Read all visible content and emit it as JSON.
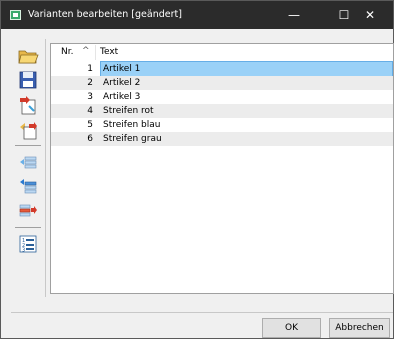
{
  "window": {
    "title": "Varianten bearbeiten [geändert]",
    "min_glyph": "—",
    "max_glyph": "☐",
    "close_glyph": "✕"
  },
  "toolbar": {
    "icons": [
      "open-folder-icon",
      "save-icon",
      "import-icon",
      "export-icon",
      "insert-before-icon",
      "insert-after-icon",
      "move-right-icon",
      "numbered-list-icon"
    ]
  },
  "list": {
    "columns": {
      "nr": "Nr.",
      "sort_glyph": "^",
      "text": "Text"
    },
    "rows": [
      {
        "nr": "1",
        "text": "Artikel 1",
        "selected": true
      },
      {
        "nr": "2",
        "text": "Artikel 2"
      },
      {
        "nr": "3",
        "text": "Artikel 3"
      },
      {
        "nr": "4",
        "text": "Streifen rot"
      },
      {
        "nr": "5",
        "text": "Streifen blau"
      },
      {
        "nr": "6",
        "text": "Streifen grau"
      }
    ]
  },
  "buttons": {
    "ok": "OK",
    "cancel": "Abbrechen"
  },
  "colors": {
    "titlebar": "#2b2b2b",
    "selection": "#9ad1f7",
    "alt_row": "#ececec"
  }
}
